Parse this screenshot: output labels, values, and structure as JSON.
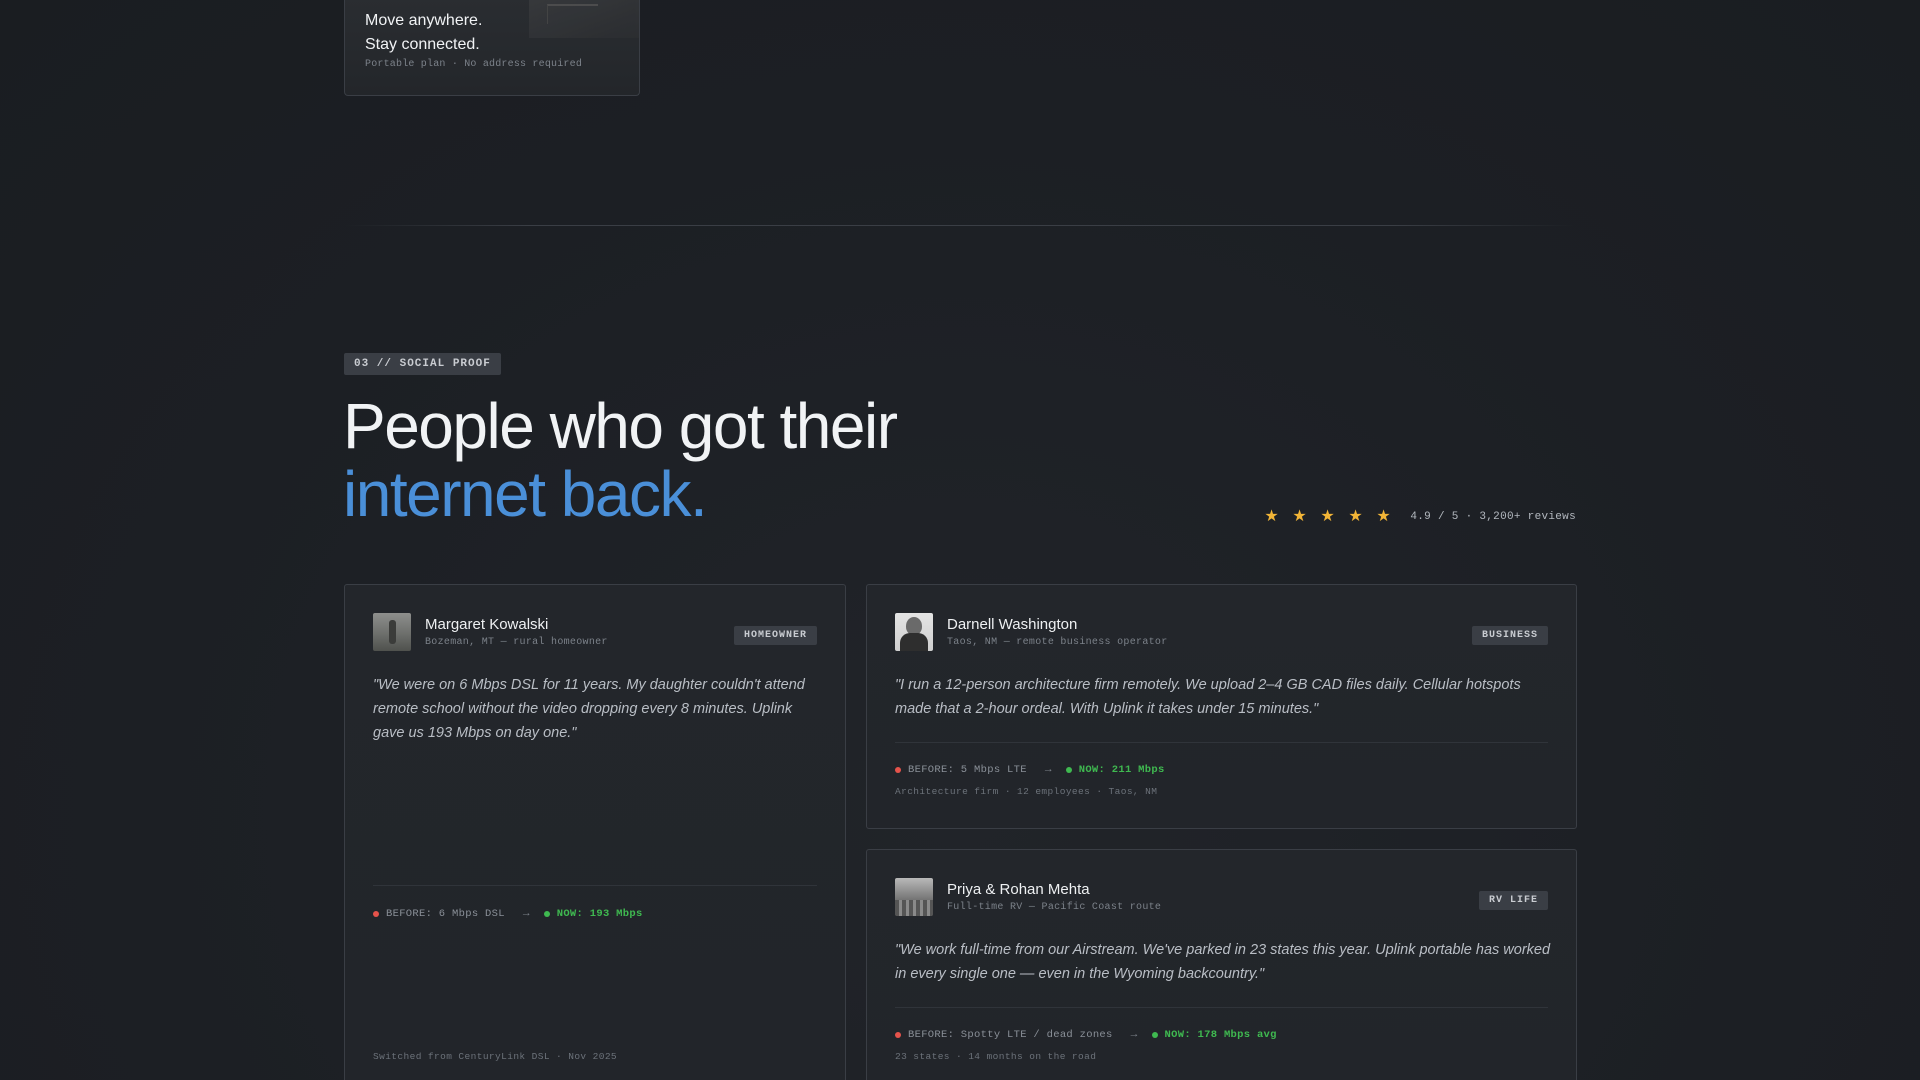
{
  "promo": {
    "title_line1": "Move anywhere.",
    "title_line2": "Stay connected.",
    "subtitle": "Portable plan · No address required"
  },
  "section": {
    "tag": "03 // SOCIAL PROOF",
    "headline_line1": "People who got their",
    "headline_line2": "internet back.",
    "accent_color": "#4a8fd8"
  },
  "rating": {
    "stars": 5,
    "star_icon": "star-icon",
    "star_color": "#f2b537",
    "text": "4.9 / 5 · 3,200+ reviews"
  },
  "testimonials": [
    {
      "name": "Margaret Kowalski",
      "meta": "Bozeman, MT — rural homeowner",
      "badge": "HOMEOWNER",
      "quote": "\"We were on 6 Mbps DSL for 11 years. My daughter couldn't attend remote school without the video dropping every 8 minutes. Uplink gave us 193 Mbps on day one.\"",
      "before": "BEFORE: 6 Mbps DSL",
      "now": "NOW: 193 Mbps",
      "detail": "Switched from CenturyLink DSL · Nov 2025"
    },
    {
      "name": "Darnell Washington",
      "meta": "Taos, NM — remote business operator",
      "badge": "BUSINESS",
      "quote": "\"I run a 12-person architecture firm remotely. We upload 2–4 GB CAD files daily. Cellular hotspots made that a 2-hour ordeal. With Uplink it takes under 15 minutes.\"",
      "before": "BEFORE: 5 Mbps LTE",
      "now": "NOW: 211 Mbps",
      "detail": "Architecture firm · 12 employees · Taos, NM"
    },
    {
      "name": "Priya & Rohan Mehta",
      "meta": "Full-time RV — Pacific Coast route",
      "badge": "RV LIFE",
      "quote": "\"We work full-time from our Airstream. We've parked in 23 states this year. Uplink portable has worked in every single one — even in the Wyoming backcountry.\"",
      "before": "BEFORE: Spotty LTE / dead zones",
      "now": "NOW: 178 Mbps avg",
      "detail": "23 states · 14 months on the road"
    }
  ],
  "colors": {
    "before_dot": "#e5534b",
    "now_dot": "#3fb950"
  },
  "arrow_glyph": "→",
  "star_glyph": "★"
}
